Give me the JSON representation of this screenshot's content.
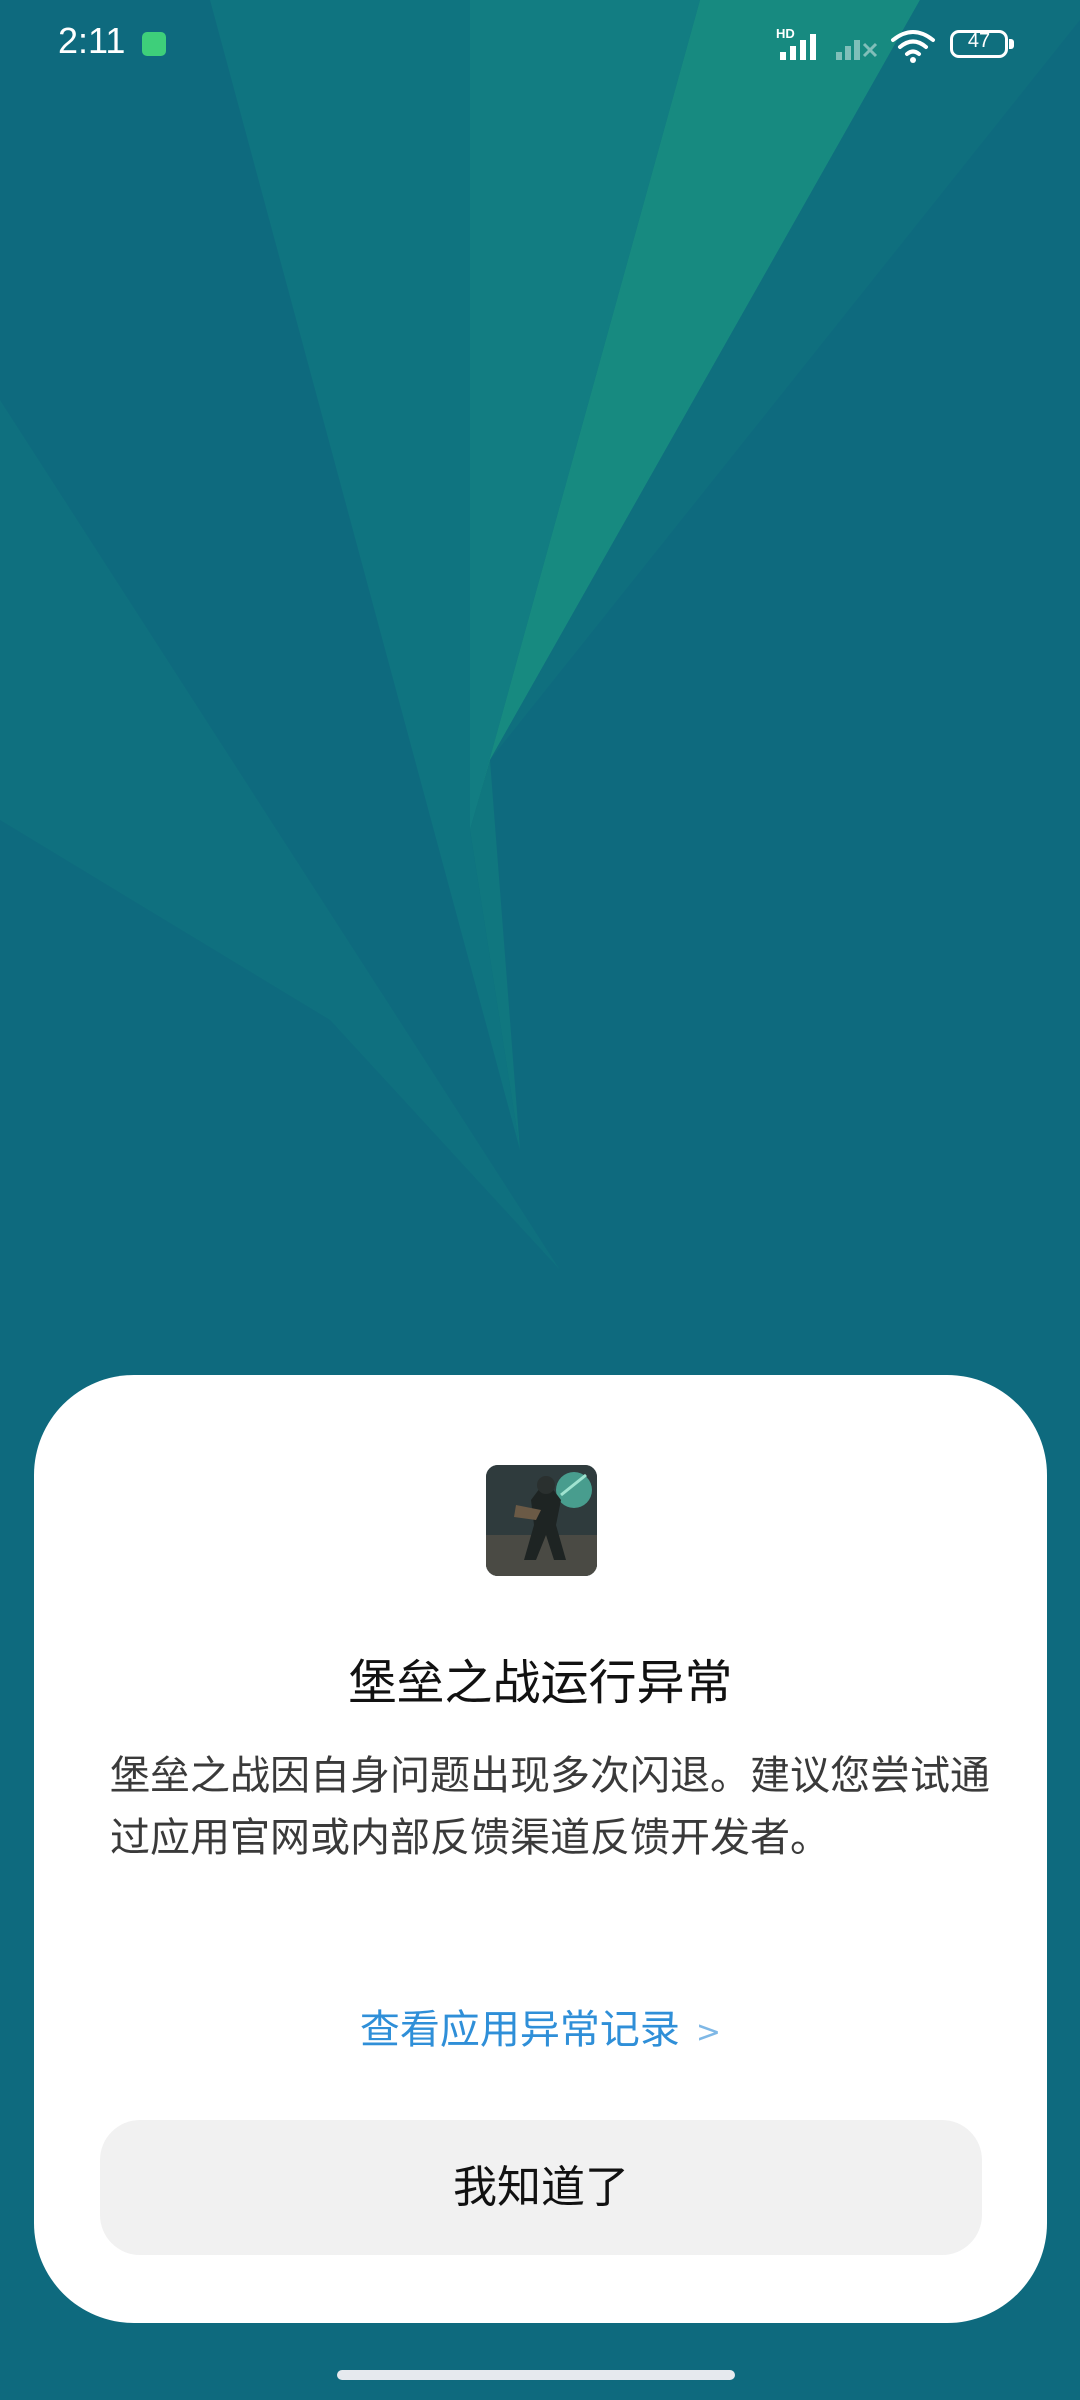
{
  "status_bar": {
    "time": "2:11",
    "network_label": "HD",
    "battery_level": "47",
    "battery_fraction": 0.47
  },
  "icons": {
    "status_app": "screen-recorder-icon",
    "signal_1": "cell-signal-icon",
    "signal_2": "cell-signal-no-service-icon",
    "wifi": "wifi-icon",
    "battery": "battery-icon"
  },
  "colors": {
    "background": "#0e6a7e",
    "accent_link": "#2f8fd8",
    "button_bg": "#f1f1f1",
    "dialog_bg": "#ffffff"
  },
  "dialog": {
    "title": "堡垒之战运行异常",
    "message": "堡垒之战因自身问题出现多次闪退。建议您尝试通过应用官网或内部反馈渠道反馈开发者。",
    "record_link": "查看应用异常记录",
    "record_link_chevron": ">",
    "ok_button": "我知道了"
  }
}
